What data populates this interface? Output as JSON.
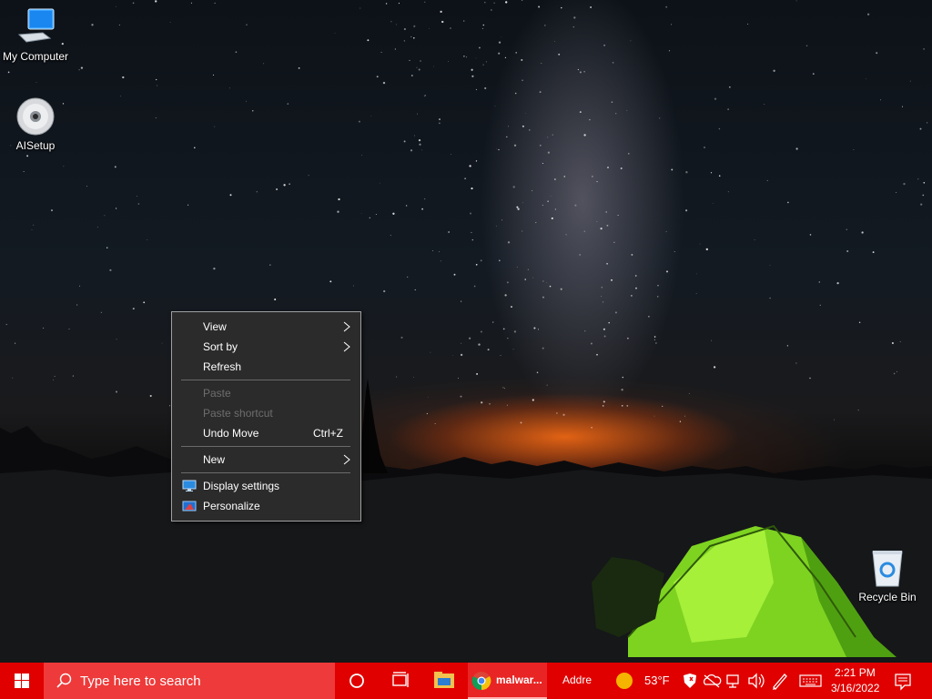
{
  "desktop": {
    "icons": [
      {
        "label": "My Computer"
      },
      {
        "label": "AISetup"
      },
      {
        "label": "Recycle Bin"
      }
    ]
  },
  "context_menu": {
    "items": [
      {
        "label": "View",
        "submenu": true,
        "enabled": true
      },
      {
        "label": "Sort by",
        "submenu": true,
        "enabled": true
      },
      {
        "label": "Refresh",
        "enabled": true
      },
      {
        "label": "Paste",
        "enabled": false
      },
      {
        "label": "Paste shortcut",
        "enabled": false
      },
      {
        "label": "Undo Move",
        "shortcut": "Ctrl+Z",
        "enabled": true
      },
      {
        "label": "New",
        "submenu": true,
        "enabled": true
      },
      {
        "label": "Display settings",
        "icon": "display-icon",
        "enabled": true
      },
      {
        "label": "Personalize",
        "icon": "personalize-icon",
        "enabled": true
      }
    ]
  },
  "taskbar": {
    "search_placeholder": "Type here to search",
    "apps": [
      {
        "label": "malwar...",
        "icon": "chrome-icon"
      },
      {
        "label": "Addre"
      }
    ],
    "weather": {
      "temp": "53°F",
      "icon": "sun-icon"
    },
    "clock": {
      "time": "2:21 PM",
      "date": "3/16/2022"
    },
    "colors": {
      "taskbar": "#e00000",
      "search": "#ee3a3a",
      "menu_bg": "#2b2b2b"
    }
  }
}
